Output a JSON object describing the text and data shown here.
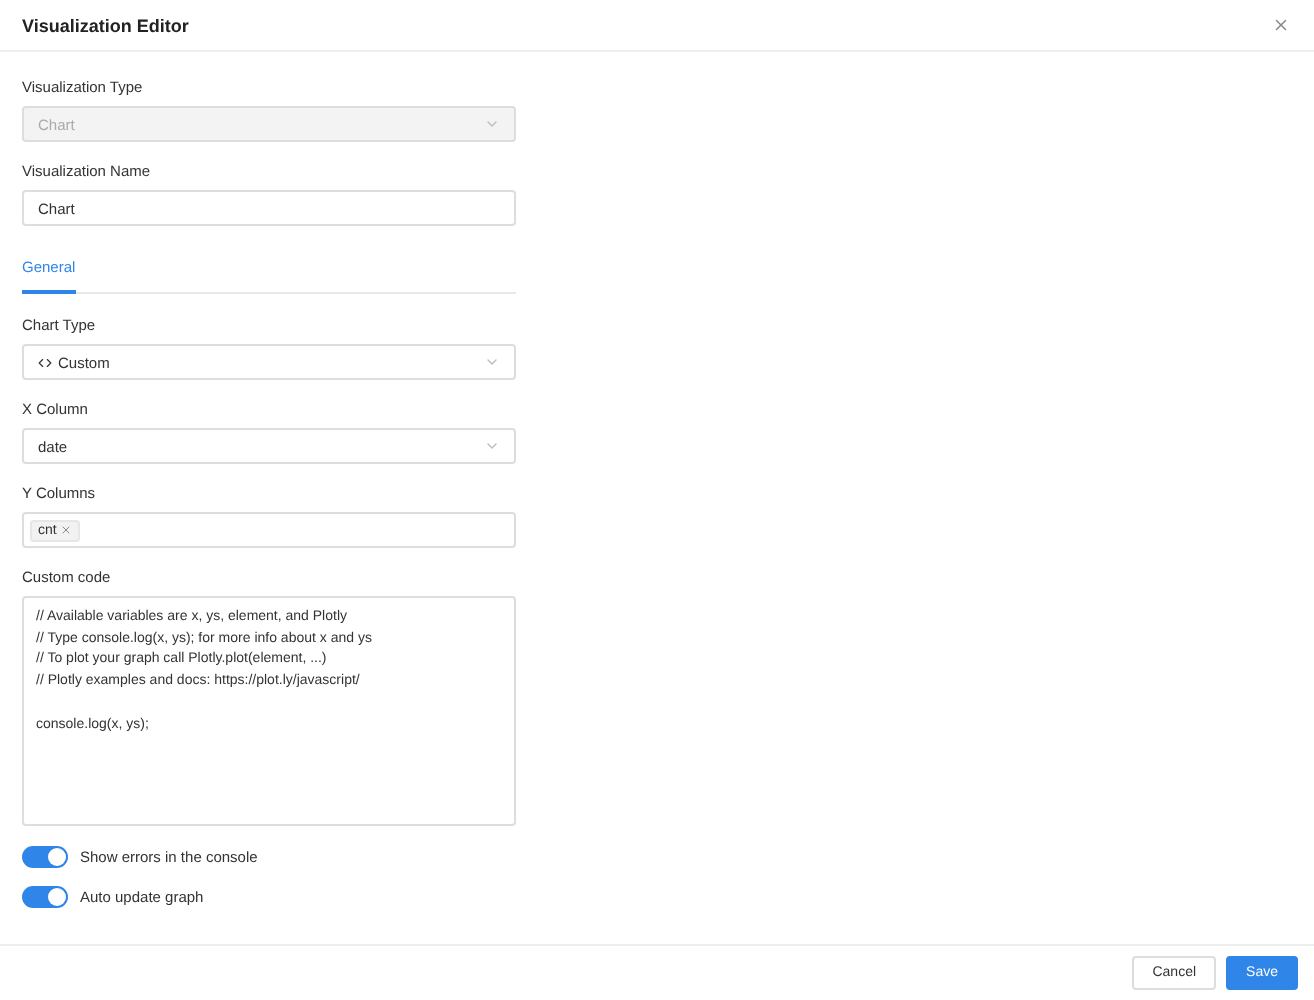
{
  "dialog": {
    "title": "Visualization Editor"
  },
  "visualization_type": {
    "label": "Visualization Type",
    "value": "Chart",
    "disabled": true
  },
  "visualization_name": {
    "label": "Visualization Name",
    "value": "Chart"
  },
  "tabs": [
    {
      "label": "General",
      "selected": true
    }
  ],
  "chart_type": {
    "label": "Chart Type",
    "value": "Custom"
  },
  "x_column": {
    "label": "X Column",
    "value": "date"
  },
  "y_columns": {
    "label": "Y Columns",
    "tags": [
      "cnt"
    ]
  },
  "custom_code": {
    "label": "Custom code",
    "value": "// Available variables are x, ys, element, and Plotly\n// Type console.log(x, ys); for more info about x and ys\n// To plot your graph call Plotly.plot(element, ...)\n// Plotly examples and docs: https://plot.ly/javascript/\n\nconsole.log(x, ys);"
  },
  "toggles": [
    {
      "label": "Show errors in the console",
      "on": true
    },
    {
      "label": "Auto update graph",
      "on": true
    }
  ],
  "buttons": [
    {
      "label": "Cancel",
      "kind": "secondary"
    },
    {
      "label": "Save",
      "kind": "primary"
    }
  ]
}
